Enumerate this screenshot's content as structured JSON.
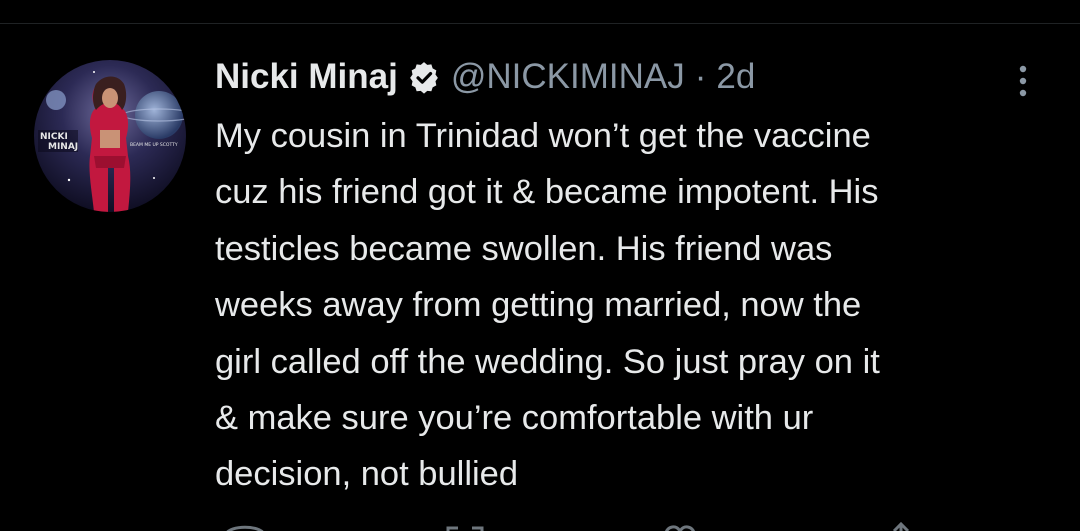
{
  "tweet": {
    "author": {
      "display_name": "Nicki Minaj",
      "handle": "@NICKIMINAJ",
      "verified": true,
      "avatar_text": "NICKI MINAJ",
      "avatar_caption": "BEAM ME UP SCOTTY"
    },
    "separator": "·",
    "time_ago": "2d",
    "text": "My cousin in Trinidad won’t get the vaccine\ncuz his friend got it & became impotent. His\ntesticles became swollen. His friend was\nweeks away from getting married, now the\ngirl called off the wedding. So just pray on it\n& make sure you’re comfortable with ur\ndecision, not bullied"
  },
  "icons": {
    "verified": "verified-badge-icon",
    "more": "more-options-icon"
  },
  "colors": {
    "background": "#000000",
    "text_primary": "#e7e9ea",
    "text_secondary": "#8b98a5",
    "divider": "#1f2224"
  }
}
